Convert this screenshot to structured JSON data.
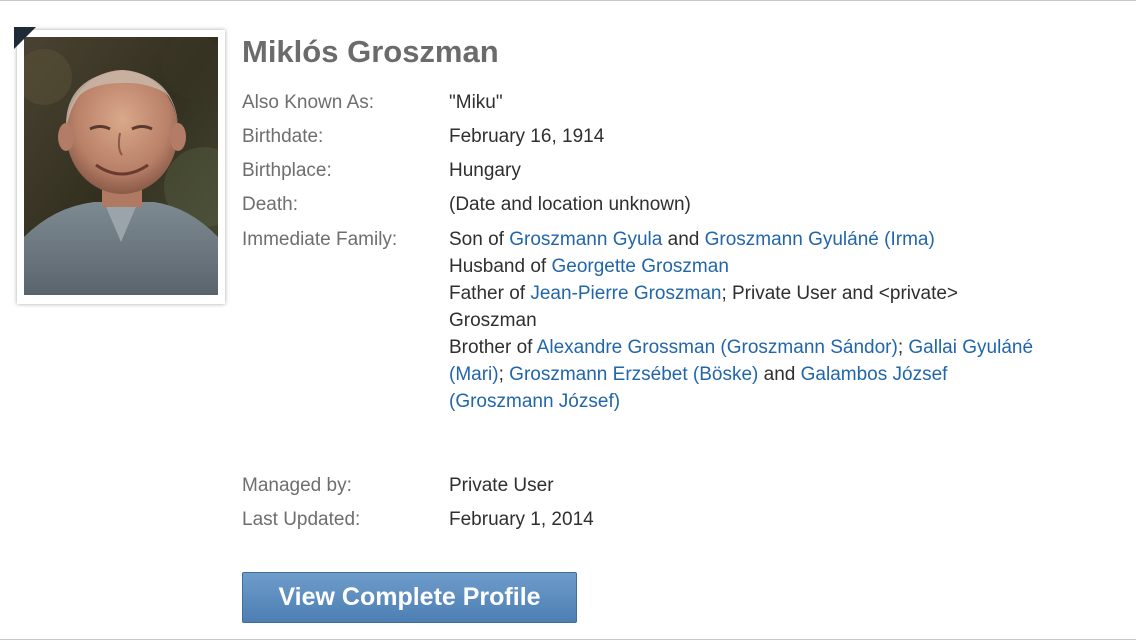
{
  "profile": {
    "name": "Miklós Groszman",
    "photo_alt": "Miklós Groszman"
  },
  "fields": {
    "aka_label": "Also Known As:",
    "aka_value": "\"Miku\"",
    "birthdate_label": "Birthdate:",
    "birthdate_value": "February 16, 1914",
    "birthplace_label": "Birthplace:",
    "birthplace_value": "Hungary",
    "death_label": "Death:",
    "death_value": "(Date and location unknown)",
    "family_label": "Immediate Family:",
    "managed_label": "Managed by:",
    "managed_value": "Private User",
    "updated_label": "Last Updated:",
    "updated_value": "February 1, 2014"
  },
  "family": {
    "son_of": "Son of ",
    "father_name": "Groszmann Gyula",
    "and_1": " and ",
    "mother_name": "Groszmann Gyuláné (Irma)",
    "husband_of": "Husband of ",
    "wife_name": "Georgette Groszman",
    "father_of": "Father of ",
    "child_name": "Jean-Pierre Groszman",
    "children_rest_1": "; Private User and <private>",
    "children_rest_2": "Groszman",
    "brother_of": "Brother of ",
    "sibling_1": "Alexandre Grossman (Groszmann Sándor)",
    "sep_1": "; ",
    "sibling_2_part1": "Gallai Gyuláné",
    "sibling_2_part2": "(Mari)",
    "sep_2": "; ",
    "sibling_3": "Groszmann Erzsébet (Böske)",
    "and_2": " and ",
    "sibling_4_part1": "Galambos József",
    "sibling_4_part2": "(Groszmann József)"
  },
  "actions": {
    "view_profile_label": "View Complete Profile"
  },
  "colors": {
    "link": "#2266aa",
    "label": "#6e6e6e",
    "value": "#2f2f2f",
    "button": "#4d7fb3"
  }
}
